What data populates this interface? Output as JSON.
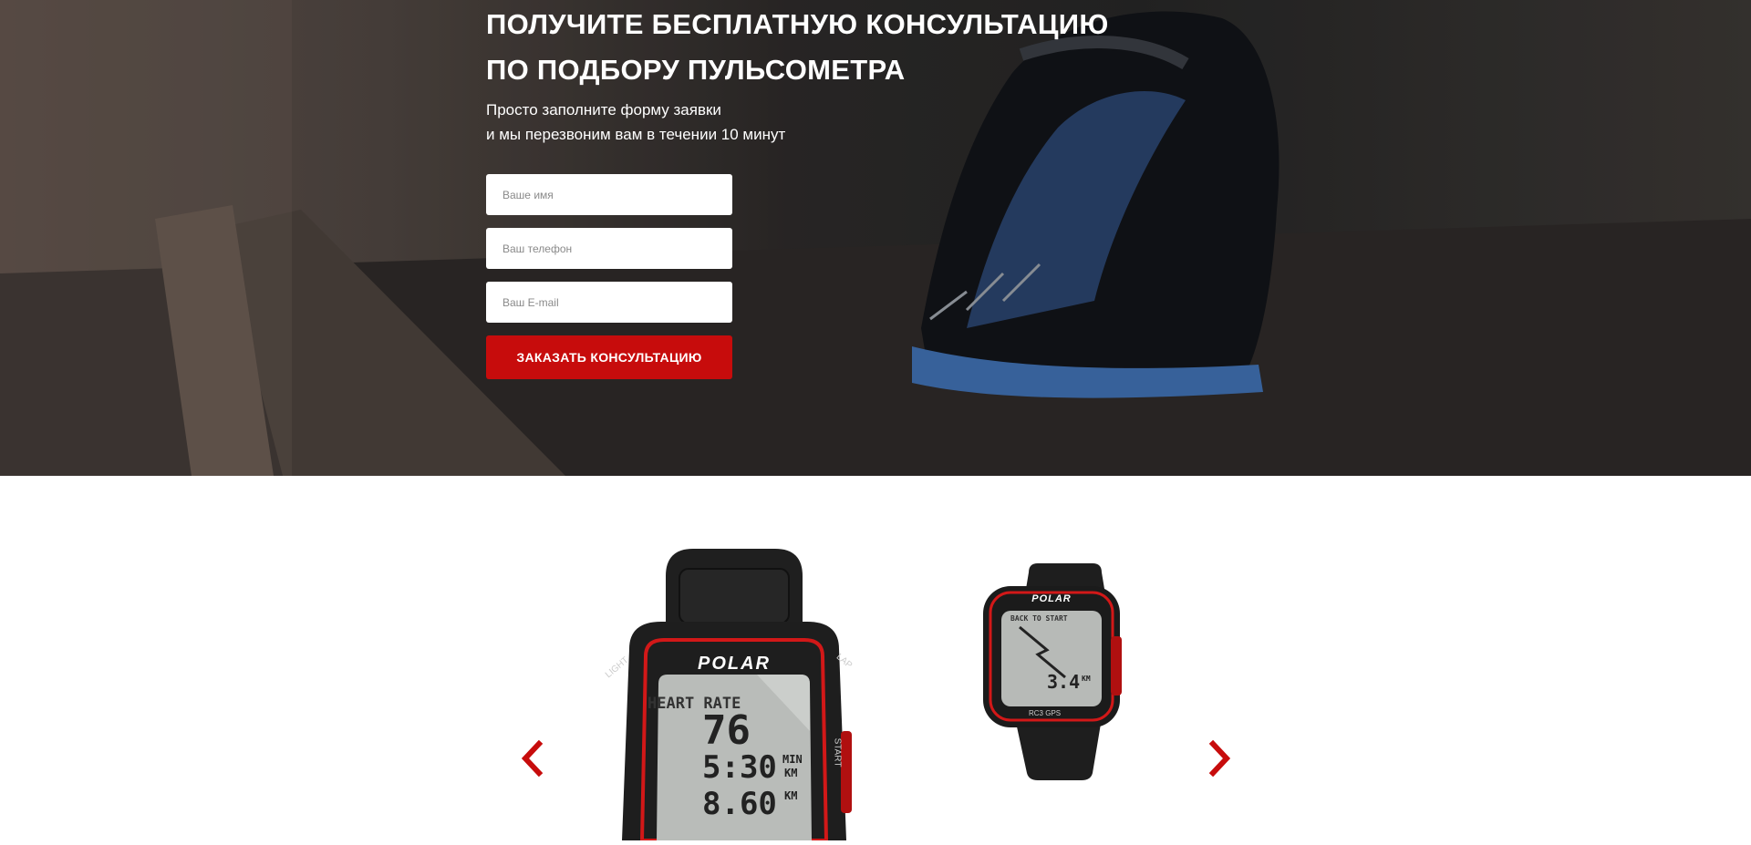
{
  "hero": {
    "title_line1": "ПОЛУЧИТЕ БЕСПЛАТНУЮ КОНСУЛЬТАЦИЮ",
    "title_line2": "ПО ПОДБОРУ ПУЛЬСОМЕТРА",
    "subtitle_line1": "Просто заполните форму заявки",
    "subtitle_line2": "и мы перезвоним вам в течении 10 минут",
    "background_image": "runner-shoes-on-treadmill"
  },
  "form": {
    "name_placeholder": "Ваше имя",
    "phone_placeholder": "Ваш телефон",
    "email_placeholder": "Ваш E-mail",
    "submit_label": "ЗАКАЗАТЬ КОНСУЛЬТАЦИЮ"
  },
  "carousel": {
    "prev_icon": "chevron-left-icon",
    "next_icon": "chevron-right-icon",
    "slides": [
      {
        "brand": "POLAR",
        "bezel_left": "LIGHT",
        "bezel_right_top": "LAP",
        "bezel_right": "START",
        "screen_title": "HEART RATE",
        "heart_rate": "76",
        "pace": "5:30",
        "pace_unit_top": "MIN",
        "pace_unit_bottom": "KM",
        "distance": "8.60",
        "distance_unit": "KM"
      },
      {
        "brand": "POLAR",
        "screen_title": "BACK TO START",
        "distance": "3.4",
        "distance_unit": "KM",
        "model": "RC3 GPS"
      }
    ]
  },
  "colors": {
    "accent": "#c70c0c",
    "hero_text": "#ffffff",
    "watch_body": "#1e1e1e",
    "watch_bezel": "#d21818",
    "lcd": "#b9bcb9"
  }
}
